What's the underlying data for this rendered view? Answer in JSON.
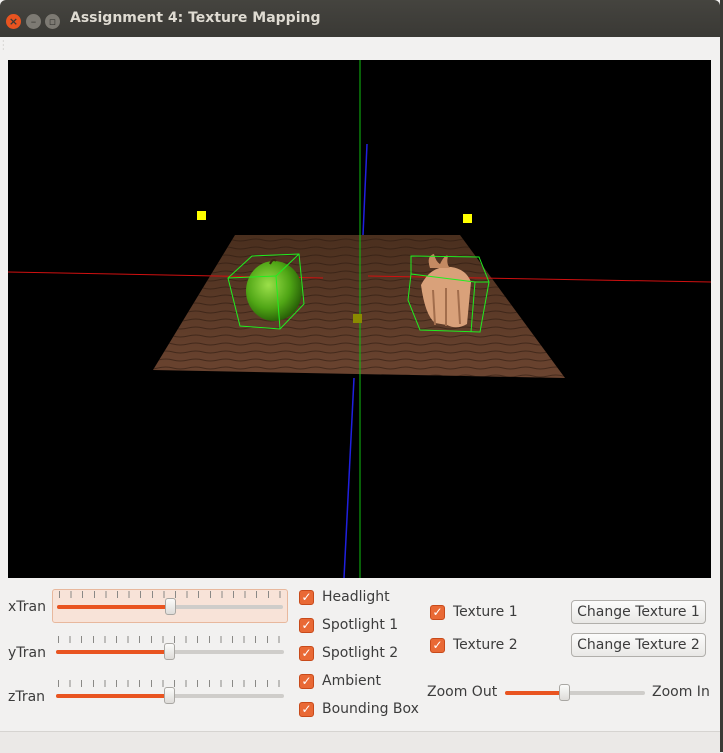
{
  "window": {
    "title": "Assignment 4: Texture Mapping",
    "close_glyph": "×",
    "minimize_glyph": "–",
    "maximize_glyph": "▫"
  },
  "sliders": [
    {
      "label": "xTran",
      "value": 0.5,
      "focused": true
    },
    {
      "label": "yTran",
      "value": 0.5,
      "focused": false
    },
    {
      "label": "zTran",
      "value": 0.5,
      "focused": false
    }
  ],
  "lighting_checkboxes": [
    {
      "label": "Headlight",
      "checked": true
    },
    {
      "label": "Spotlight 1",
      "checked": true
    },
    {
      "label": "Spotlight 2",
      "checked": true
    },
    {
      "label": "Ambient",
      "checked": true
    },
    {
      "label": "Bounding Box",
      "checked": true
    }
  ],
  "texture_checkboxes": [
    {
      "label": "Texture 1",
      "checked": true
    },
    {
      "label": "Texture 2",
      "checked": true
    }
  ],
  "buttons": {
    "change_texture_1": "Change Texture 1",
    "change_texture_2": "Change Texture 2"
  },
  "zoom": {
    "out_label": "Zoom Out",
    "in_label": "Zoom In",
    "value": 0.42
  },
  "colors": {
    "accent": "#e95420",
    "scene_background": "#000000",
    "axis_x": "#d01010",
    "axis_y": "#10c010",
    "axis_z": "#2020e0",
    "light_marker": "#ffff00",
    "bounding_box": "#20ee20"
  }
}
